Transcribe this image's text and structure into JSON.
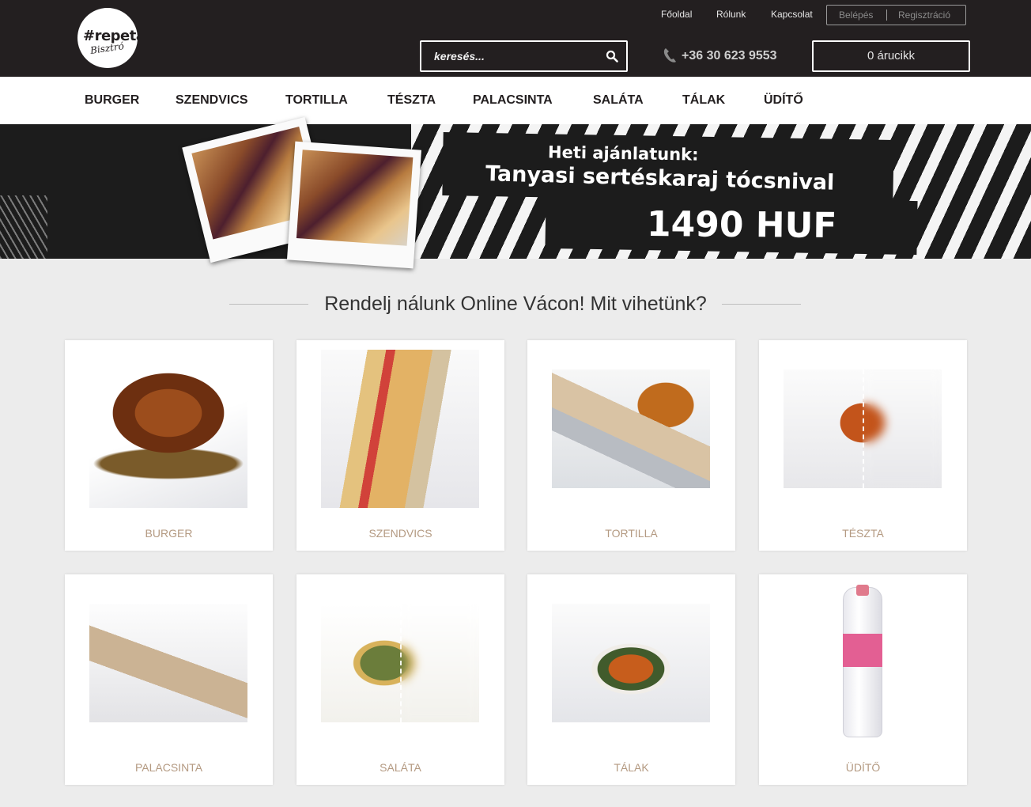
{
  "logo": {
    "line1": "#repeta",
    "line2": "Bisztró"
  },
  "top_links": [
    "Főoldal",
    "Rólunk",
    "Kapcsolat"
  ],
  "auth": {
    "login": "Belépés",
    "register": "Regisztráció"
  },
  "search": {
    "placeholder": "keresés..."
  },
  "phone": "+36 30 623 9553",
  "cart": "0 árucikk",
  "categories_nav": [
    "BURGER",
    "SZENDVICS",
    "TORTILLA",
    "TÉSZTA",
    "PALACSINTA",
    "SALÁTA",
    "TÁLAK",
    "ÜDÍTŐ"
  ],
  "banner": {
    "line1": "Heti ajánlatunk:",
    "line2": "Tanyasi sertéskaraj tócsnival",
    "price": "1490 HUF"
  },
  "section_title": "Rendelj nálunk Online Vácon! Mit vihetünk?",
  "cards": [
    {
      "name": "BURGER"
    },
    {
      "name": "SZENDVICS"
    },
    {
      "name": "TORTILLA"
    },
    {
      "name": "TÉSZTA"
    },
    {
      "name": "PALACSINTA"
    },
    {
      "name": "SALÁTA"
    },
    {
      "name": "TÁLAK"
    },
    {
      "name": "ÜDÍTŐ"
    }
  ],
  "colors": {
    "header_bg": "#231f20",
    "page_bg": "#ececec",
    "card_label": "#b49a82"
  }
}
